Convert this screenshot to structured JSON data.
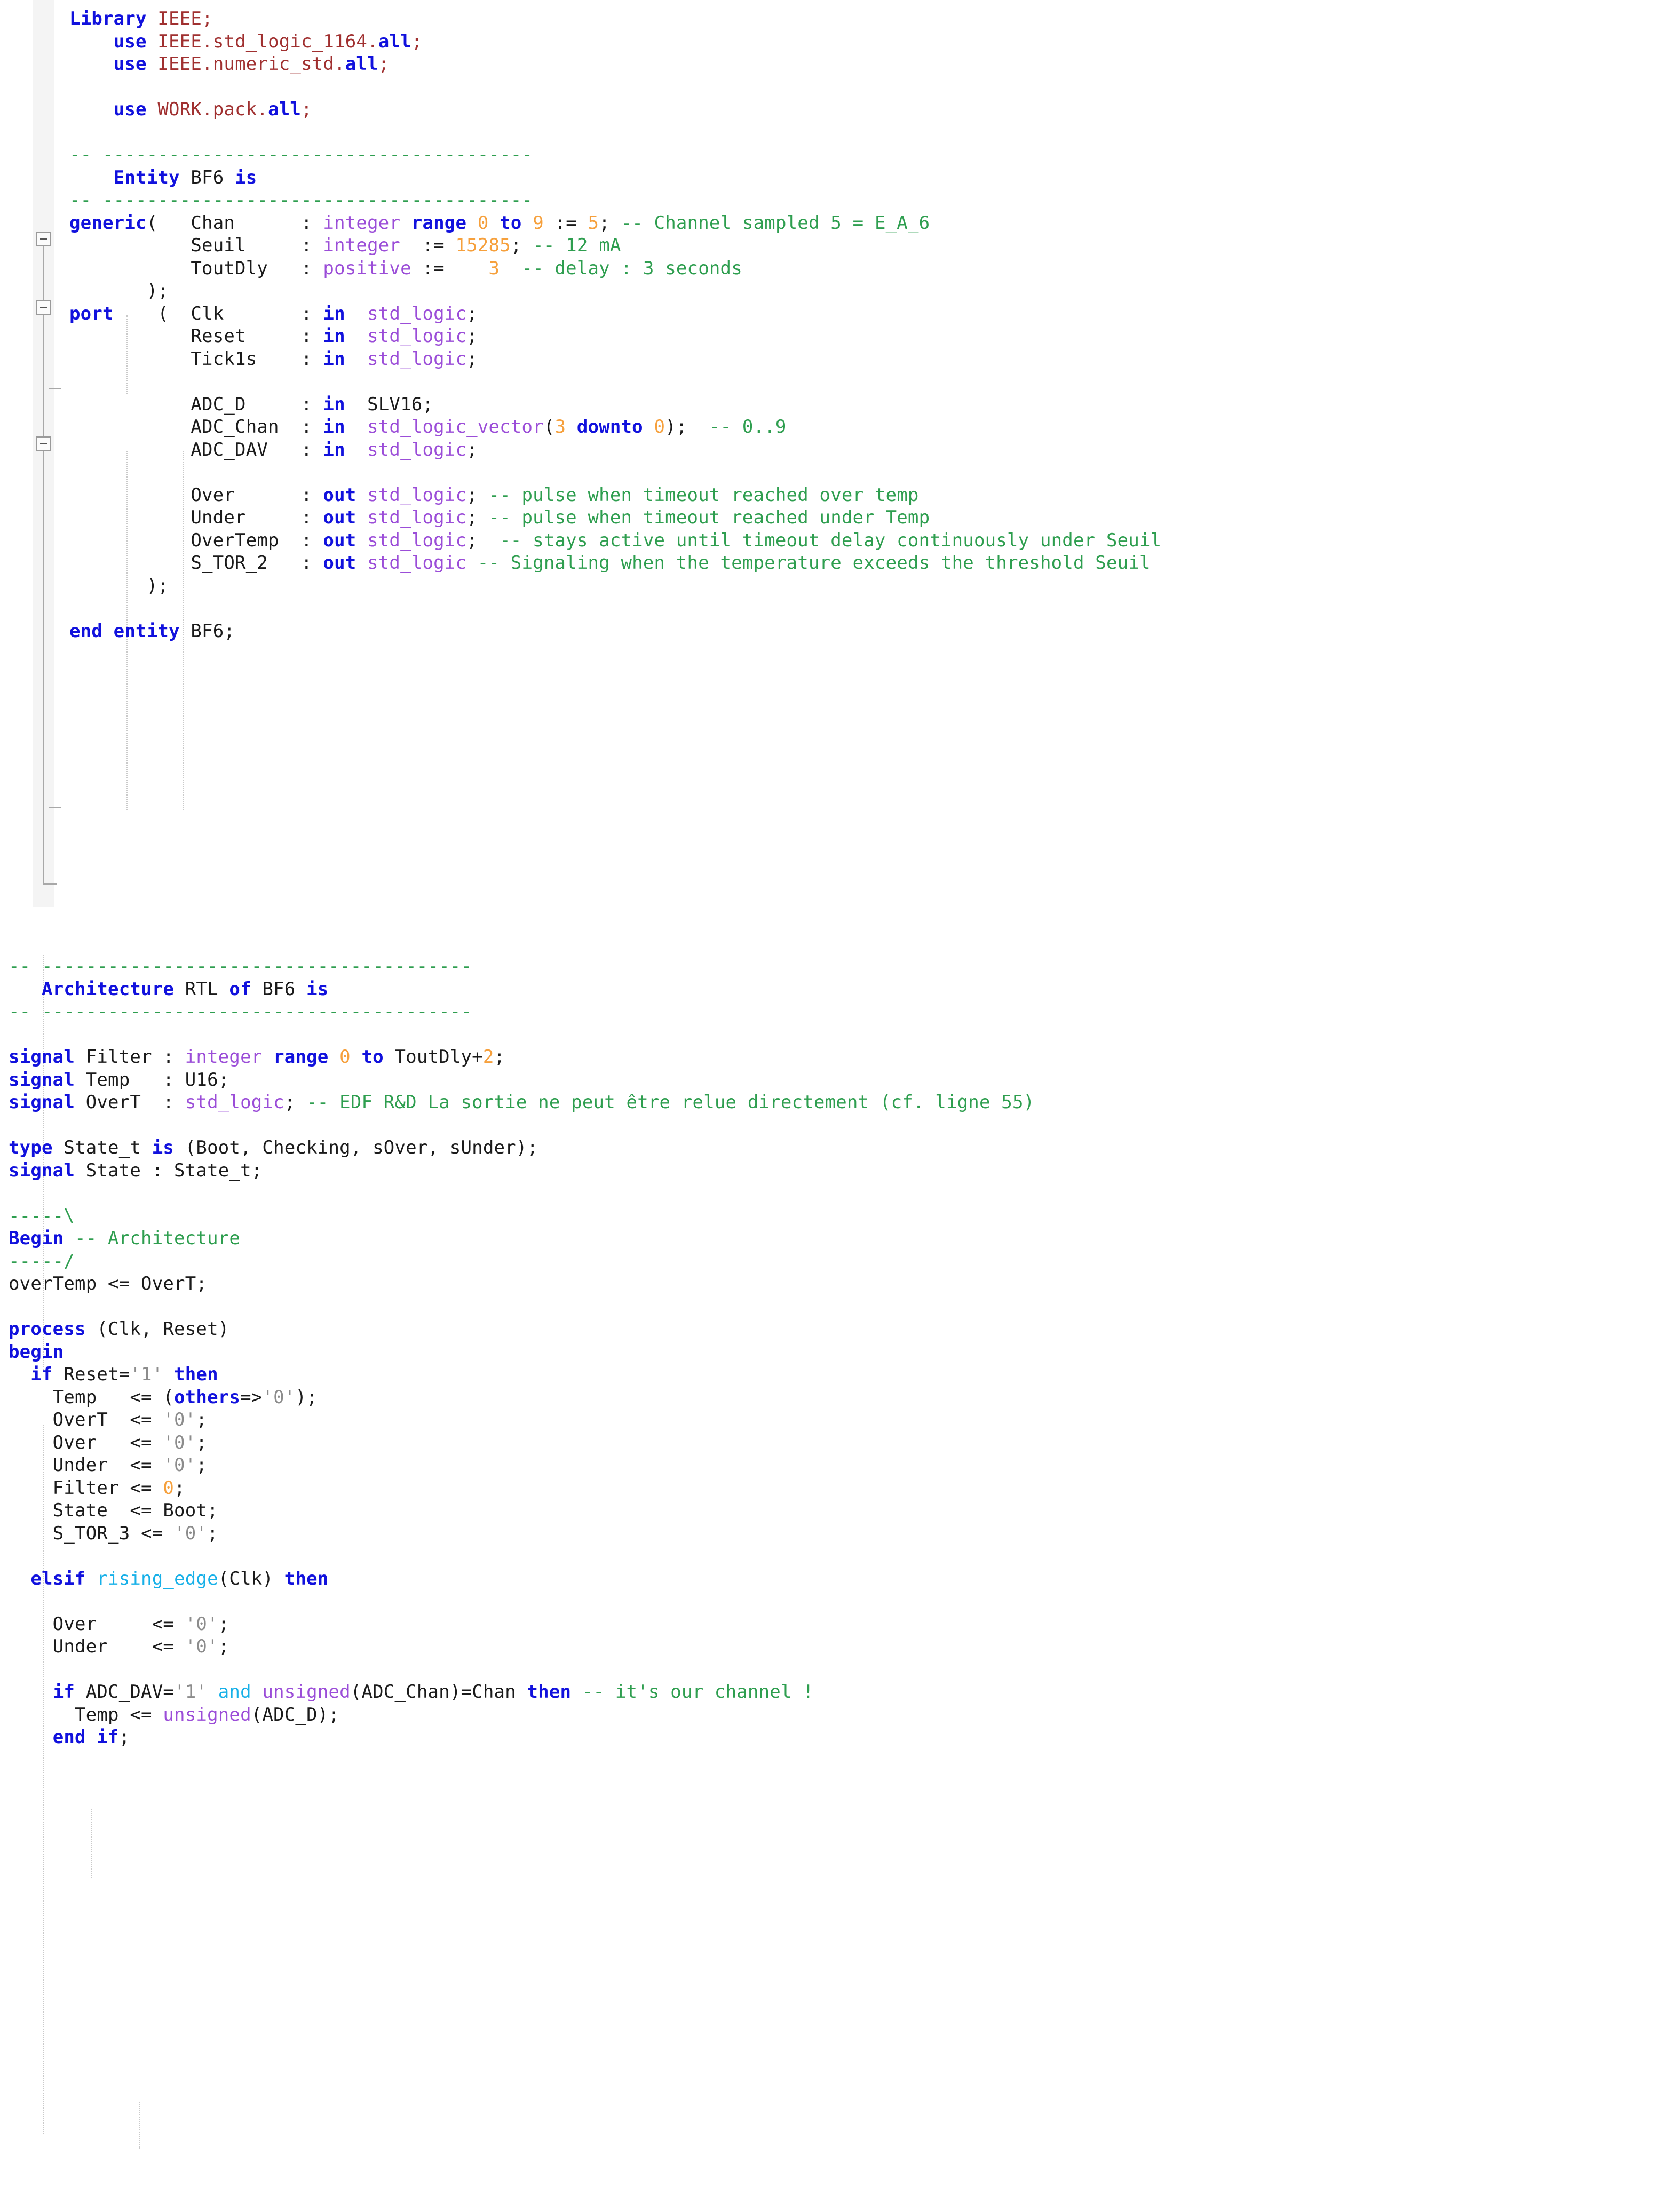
{
  "document": {
    "language": "VHDL",
    "entity_name": "BF6",
    "architecture_name": "RTL"
  },
  "colors": {
    "keyword": "#1111dd",
    "type": "#9b4dd8",
    "number": "#f6a03c",
    "comment": "#2e9e4f",
    "literal": "#8c8c8c",
    "function": "#17b0e8",
    "string": "#a03030",
    "identifier": "#1a1a1a",
    "background": "#ffffff",
    "gutter": "#f3f3f3"
  },
  "section_entity": {
    "lines": [
      [
        {
          "t": "Library",
          "c": "kw"
        },
        {
          "t": " "
        },
        {
          "t": "IEEE",
          "c": "str"
        },
        {
          "t": ";",
          "c": "str"
        }
      ],
      [
        {
          "t": "    "
        },
        {
          "t": "use",
          "c": "kw"
        },
        {
          "t": " "
        },
        {
          "t": "IEEE.std_logic_1164.",
          "c": "str"
        },
        {
          "t": "all",
          "c": "kw"
        },
        {
          "t": ";",
          "c": "str"
        }
      ],
      [
        {
          "t": "    "
        },
        {
          "t": "use",
          "c": "kw"
        },
        {
          "t": " "
        },
        {
          "t": "IEEE.numeric_std.",
          "c": "str"
        },
        {
          "t": "all",
          "c": "kw"
        },
        {
          "t": ";",
          "c": "str"
        }
      ],
      [],
      [
        {
          "t": "    "
        },
        {
          "t": "use",
          "c": "kw"
        },
        {
          "t": " "
        },
        {
          "t": "WORK.pack.",
          "c": "str"
        },
        {
          "t": "all",
          "c": "kw"
        },
        {
          "t": ";",
          "c": "str"
        }
      ],
      [],
      [
        {
          "t": "-- ---------------------------------------",
          "c": "cmt"
        }
      ],
      [
        {
          "t": "    "
        },
        {
          "t": "Entity",
          "c": "kw"
        },
        {
          "t": " BF6 "
        },
        {
          "t": "is",
          "c": "kw"
        }
      ],
      [
        {
          "t": "-- ---------------------------------------",
          "c": "cmt"
        }
      ],
      [
        {
          "t": "generic",
          "c": "kw"
        },
        {
          "t": "(   Chan      : "
        },
        {
          "t": "integer",
          "c": "typ"
        },
        {
          "t": " "
        },
        {
          "t": "range",
          "c": "kw"
        },
        {
          "t": " "
        },
        {
          "t": "0",
          "c": "num"
        },
        {
          "t": " "
        },
        {
          "t": "to",
          "c": "kw"
        },
        {
          "t": " "
        },
        {
          "t": "9",
          "c": "num"
        },
        {
          "t": " "
        },
        {
          "t": ":=",
          "c": "op"
        },
        {
          "t": " "
        },
        {
          "t": "5",
          "c": "num"
        },
        {
          "t": "; "
        },
        {
          "t": "-- Channel sampled 5 = E_A_6",
          "c": "cmt"
        }
      ],
      [
        {
          "t": "           Seuil     : "
        },
        {
          "t": "integer",
          "c": "typ"
        },
        {
          "t": "  "
        },
        {
          "t": ":=",
          "c": "op"
        },
        {
          "t": " "
        },
        {
          "t": "15285",
          "c": "num"
        },
        {
          "t": "; "
        },
        {
          "t": "-- 12 mA",
          "c": "cmt"
        }
      ],
      [
        {
          "t": "           ToutDly   : "
        },
        {
          "t": "positive",
          "c": "typ"
        },
        {
          "t": " "
        },
        {
          "t": ":=",
          "c": "op"
        },
        {
          "t": "    "
        },
        {
          "t": "3",
          "c": "num"
        },
        {
          "t": "  "
        },
        {
          "t": "-- delay : 3 seconds",
          "c": "cmt"
        }
      ],
      [
        {
          "t": "       );"
        }
      ],
      [
        {
          "t": "port",
          "c": "kw"
        },
        {
          "t": "    (  Clk       : "
        },
        {
          "t": "in",
          "c": "kw"
        },
        {
          "t": "  "
        },
        {
          "t": "std_logic",
          "c": "typ"
        },
        {
          "t": ";"
        }
      ],
      [
        {
          "t": "           Reset     : "
        },
        {
          "t": "in",
          "c": "kw"
        },
        {
          "t": "  "
        },
        {
          "t": "std_logic",
          "c": "typ"
        },
        {
          "t": ";"
        }
      ],
      [
        {
          "t": "           Tick1s    : "
        },
        {
          "t": "in",
          "c": "kw"
        },
        {
          "t": "  "
        },
        {
          "t": "std_logic",
          "c": "typ"
        },
        {
          "t": ";"
        }
      ],
      [],
      [
        {
          "t": "           ADC_D     : "
        },
        {
          "t": "in",
          "c": "kw"
        },
        {
          "t": "  SLV16;"
        }
      ],
      [
        {
          "t": "           ADC_Chan  : "
        },
        {
          "t": "in",
          "c": "kw"
        },
        {
          "t": "  "
        },
        {
          "t": "std_logic_vector",
          "c": "typ"
        },
        {
          "t": "("
        },
        {
          "t": "3",
          "c": "num"
        },
        {
          "t": " "
        },
        {
          "t": "downto",
          "c": "kw"
        },
        {
          "t": " "
        },
        {
          "t": "0",
          "c": "num"
        },
        {
          "t": ");  "
        },
        {
          "t": "-- 0..9",
          "c": "cmt"
        }
      ],
      [
        {
          "t": "           ADC_DAV   : "
        },
        {
          "t": "in",
          "c": "kw"
        },
        {
          "t": "  "
        },
        {
          "t": "std_logic",
          "c": "typ"
        },
        {
          "t": ";"
        }
      ],
      [],
      [
        {
          "t": "           Over      : "
        },
        {
          "t": "out",
          "c": "kw"
        },
        {
          "t": " "
        },
        {
          "t": "std_logic",
          "c": "typ"
        },
        {
          "t": "; "
        },
        {
          "t": "-- pulse when timeout reached over temp",
          "c": "cmt"
        }
      ],
      [
        {
          "t": "           Under     : "
        },
        {
          "t": "out",
          "c": "kw"
        },
        {
          "t": " "
        },
        {
          "t": "std_logic",
          "c": "typ"
        },
        {
          "t": "; "
        },
        {
          "t": "-- pulse when timeout reached under Temp",
          "c": "cmt"
        }
      ],
      [
        {
          "t": "           OverTemp  : "
        },
        {
          "t": "out",
          "c": "kw"
        },
        {
          "t": " "
        },
        {
          "t": "std_logic",
          "c": "typ"
        },
        {
          "t": ";  "
        },
        {
          "t": "-- stays active until timeout delay continuously under Seuil",
          "c": "cmt"
        }
      ],
      [
        {
          "t": "           S_TOR_2   : "
        },
        {
          "t": "out",
          "c": "kw"
        },
        {
          "t": " "
        },
        {
          "t": "std_logic",
          "c": "typ"
        },
        {
          "t": " "
        },
        {
          "t": "-- Signaling when the temperature exceeds the threshold Seuil",
          "c": "cmt"
        }
      ],
      [
        {
          "t": "       );"
        }
      ],
      [],
      [
        {
          "t": "end entity",
          "c": "kw"
        },
        {
          "t": " BF6;"
        }
      ]
    ]
  },
  "section_architecture": {
    "lines": [
      [
        {
          "t": "-- ---------------------------------------",
          "c": "cmt"
        }
      ],
      [
        {
          "t": "   "
        },
        {
          "t": "Architecture",
          "c": "kw"
        },
        {
          "t": " RTL "
        },
        {
          "t": "of",
          "c": "kw"
        },
        {
          "t": " BF6 "
        },
        {
          "t": "is",
          "c": "kw"
        }
      ],
      [
        {
          "t": "-- ---------------------------------------",
          "c": "cmt"
        }
      ],
      [],
      [
        {
          "t": "signal",
          "c": "kw"
        },
        {
          "t": " Filter : "
        },
        {
          "t": "integer",
          "c": "typ"
        },
        {
          "t": " "
        },
        {
          "t": "range",
          "c": "kw"
        },
        {
          "t": " "
        },
        {
          "t": "0",
          "c": "num"
        },
        {
          "t": " "
        },
        {
          "t": "to",
          "c": "kw"
        },
        {
          "t": " ToutDly+"
        },
        {
          "t": "2",
          "c": "num"
        },
        {
          "t": ";"
        }
      ],
      [
        {
          "t": "signal",
          "c": "kw"
        },
        {
          "t": " Temp   : U16;"
        }
      ],
      [
        {
          "t": "signal",
          "c": "kw"
        },
        {
          "t": " OverT  : "
        },
        {
          "t": "std_logic",
          "c": "typ"
        },
        {
          "t": "; "
        },
        {
          "t": "-- EDF R&D La sortie ne peut être relue directement (cf. ligne 55)",
          "c": "cmt"
        }
      ],
      [],
      [
        {
          "t": "type",
          "c": "kw"
        },
        {
          "t": " State_t "
        },
        {
          "t": "is",
          "c": "kw"
        },
        {
          "t": " (Boot, Checking, sOver, sUnder);"
        }
      ],
      [
        {
          "t": "signal",
          "c": "kw"
        },
        {
          "t": " State : State_t;"
        }
      ],
      [],
      [
        {
          "t": "-----\\",
          "c": "cmt"
        }
      ],
      [
        {
          "t": "Begin",
          "c": "kw"
        },
        {
          "t": " "
        },
        {
          "t": "-- Architecture",
          "c": "cmt"
        }
      ],
      [
        {
          "t": "-----/",
          "c": "cmt"
        }
      ],
      [
        {
          "t": "overTemp "
        },
        {
          "t": "<=",
          "c": "op"
        },
        {
          "t": " OverT;"
        }
      ],
      [],
      [
        {
          "t": "process",
          "c": "kw"
        },
        {
          "t": " (Clk, Reset)"
        }
      ],
      [
        {
          "t": "begin",
          "c": "kw"
        }
      ],
      [
        {
          "t": "  "
        },
        {
          "t": "if",
          "c": "kw"
        },
        {
          "t": " Reset="
        },
        {
          "t": "'1'",
          "c": "lit"
        },
        {
          "t": " "
        },
        {
          "t": "then",
          "c": "kw"
        }
      ],
      [
        {
          "t": "    Temp   "
        },
        {
          "t": "<=",
          "c": "op"
        },
        {
          "t": " ("
        },
        {
          "t": "others",
          "c": "kw"
        },
        {
          "t": "=>"
        },
        {
          "t": "'0'",
          "c": "lit"
        },
        {
          "t": ");"
        }
      ],
      [
        {
          "t": "    OverT  "
        },
        {
          "t": "<=",
          "c": "op"
        },
        {
          "t": " "
        },
        {
          "t": "'0'",
          "c": "lit"
        },
        {
          "t": ";"
        }
      ],
      [
        {
          "t": "    Over   "
        },
        {
          "t": "<=",
          "c": "op"
        },
        {
          "t": " "
        },
        {
          "t": "'0'",
          "c": "lit"
        },
        {
          "t": ";"
        }
      ],
      [
        {
          "t": "    Under  "
        },
        {
          "t": "<=",
          "c": "op"
        },
        {
          "t": " "
        },
        {
          "t": "'0'",
          "c": "lit"
        },
        {
          "t": ";"
        }
      ],
      [
        {
          "t": "    Filter "
        },
        {
          "t": "<=",
          "c": "op"
        },
        {
          "t": " "
        },
        {
          "t": "0",
          "c": "num"
        },
        {
          "t": ";"
        }
      ],
      [
        {
          "t": "    State  "
        },
        {
          "t": "<=",
          "c": "op"
        },
        {
          "t": " Boot;"
        }
      ],
      [
        {
          "t": "    S_TOR_3 "
        },
        {
          "t": "<=",
          "c": "op"
        },
        {
          "t": " "
        },
        {
          "t": "'0'",
          "c": "lit"
        },
        {
          "t": ";"
        }
      ],
      [],
      [
        {
          "t": "  "
        },
        {
          "t": "elsif",
          "c": "kw"
        },
        {
          "t": " "
        },
        {
          "t": "rising_edge",
          "c": "fn"
        },
        {
          "t": "(Clk) "
        },
        {
          "t": "then",
          "c": "kw"
        }
      ],
      [],
      [
        {
          "t": "    Over     "
        },
        {
          "t": "<=",
          "c": "op"
        },
        {
          "t": " "
        },
        {
          "t": "'0'",
          "c": "lit"
        },
        {
          "t": ";"
        }
      ],
      [
        {
          "t": "    Under    "
        },
        {
          "t": "<=",
          "c": "op"
        },
        {
          "t": " "
        },
        {
          "t": "'0'",
          "c": "lit"
        },
        {
          "t": ";"
        }
      ],
      [],
      [
        {
          "t": "    "
        },
        {
          "t": "if",
          "c": "kw"
        },
        {
          "t": " ADC_DAV="
        },
        {
          "t": "'1'",
          "c": "lit"
        },
        {
          "t": " "
        },
        {
          "t": "and",
          "c": "fn"
        },
        {
          "t": " "
        },
        {
          "t": "unsigned",
          "c": "typ"
        },
        {
          "t": "(ADC_Chan)=Chan "
        },
        {
          "t": "then",
          "c": "kw"
        },
        {
          "t": " "
        },
        {
          "t": "-- it's our channel !",
          "c": "cmt"
        }
      ],
      [
        {
          "t": "      Temp "
        },
        {
          "t": "<=",
          "c": "op"
        },
        {
          "t": " "
        },
        {
          "t": "unsigned",
          "c": "typ"
        },
        {
          "t": "(ADC_D);"
        }
      ],
      [
        {
          "t": "    "
        },
        {
          "t": "end if",
          "c": "kw"
        },
        {
          "t": ";"
        }
      ]
    ]
  }
}
